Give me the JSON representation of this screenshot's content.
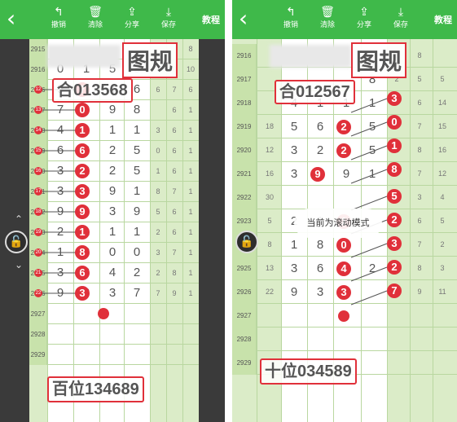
{
  "toolbar": {
    "undo": "撤销",
    "clear": "清除",
    "share": "分享",
    "save": "保存",
    "course": "教程"
  },
  "left": {
    "title": "图规",
    "sum_label": "合013568",
    "result_label": "百位134689",
    "rows": [
      {
        "no": "2915",
        "nums": [
          "",
          "",
          "",
          ""
        ],
        "side": [
          "",
          "",
          "8",
          "11"
        ]
      },
      {
        "no": "2916",
        "nums": [
          "0",
          "1",
          "5",
          "8"
        ],
        "side": [
          "7",
          "0",
          "10"
        ]
      },
      {
        "no": "2916",
        "nums": [
          "9",
          "7",
          "4",
          "6"
        ],
        "side": [
          "6",
          "7",
          "6"
        ]
      },
      {
        "no": "2917",
        "nums": [
          "7",
          "0",
          "9",
          "8"
        ],
        "side": [
          "",
          "6",
          "1"
        ]
      },
      {
        "no": "2918",
        "nums": [
          "4",
          "1",
          "1",
          "1"
        ],
        "side": [
          "3",
          "6",
          "1"
        ]
      },
      {
        "no": "2919",
        "nums": [
          "6",
          "6",
          "2",
          "5"
        ],
        "side": [
          "0",
          "6",
          "1"
        ]
      },
      {
        "no": "2920",
        "nums": [
          "3",
          "2",
          "2",
          "5"
        ],
        "side": [
          "1",
          "6",
          "1"
        ]
      },
      {
        "no": "2921",
        "nums": [
          "3",
          "3",
          "9",
          "1"
        ],
        "side": [
          "8",
          "7",
          "1"
        ]
      },
      {
        "no": "2922",
        "nums": [
          "9",
          "9",
          "3",
          "9"
        ],
        "side": [
          "5",
          "6",
          "1"
        ]
      },
      {
        "no": "2923",
        "nums": [
          "2",
          "1",
          "1",
          "1"
        ],
        "side": [
          "2",
          "6",
          "1"
        ]
      },
      {
        "no": "2924",
        "nums": [
          "1",
          "8",
          "0",
          "0"
        ],
        "side": [
          "3",
          "7",
          "1"
        ]
      },
      {
        "no": "2925",
        "nums": [
          "3",
          "6",
          "4",
          "2"
        ],
        "side": [
          "2",
          "8",
          "1"
        ]
      },
      {
        "no": "2926",
        "nums": [
          "9",
          "3",
          "3",
          "7"
        ],
        "side": [
          "7",
          "9",
          "1"
        ]
      },
      {
        "no": "2927",
        "nums": [
          "",
          "",
          "",
          ""
        ],
        "side": [
          "",
          "",
          ""
        ]
      },
      {
        "no": "2928",
        "nums": [
          "",
          "",
          "",
          ""
        ],
        "side": [
          "",
          "",
          ""
        ]
      },
      {
        "no": "2929",
        "nums": [
          "",
          "",
          "",
          ""
        ],
        "side": [
          "",
          "",
          ""
        ]
      }
    ],
    "circles": [
      "7",
      "0",
      "1",
      "6",
      "2",
      "3",
      "9",
      "1",
      "8",
      "6",
      "3"
    ]
  },
  "right": {
    "title": "图规",
    "sum_label": "合012567",
    "result_label": "十位034589",
    "toast": "当前为滚动模式",
    "rows": [
      {
        "no": "2916",
        "nums": [
          "",
          "",
          "",
          ""
        ],
        "side": [
          "3",
          "8"
        ]
      },
      {
        "no": "2917",
        "nums": [
          "",
          "",
          "",
          "8"
        ],
        "side": [
          "2",
          "5",
          "5"
        ]
      },
      {
        "no": "2918",
        "nums": [
          "4",
          "1",
          "1",
          "1"
        ],
        "side": [
          "3",
          "6",
          "14"
        ]
      },
      {
        "no": "2919",
        "nums": [
          "5",
          "6",
          "2",
          "5"
        ],
        "side": [
          "0",
          "7",
          "15"
        ],
        "left": "18"
      },
      {
        "no": "2920",
        "nums": [
          "3",
          "2",
          "2",
          "5"
        ],
        "side": [
          "1",
          "8",
          "16"
        ],
        "left": "12"
      },
      {
        "no": "2921",
        "nums": [
          "3",
          "3",
          "9",
          "1"
        ],
        "side": [
          "8",
          "7",
          "12"
        ],
        "left": "16"
      },
      {
        "no": "2922",
        "nums": [
          "",
          "",
          "",
          ""
        ],
        "side": [
          "5",
          "3",
          "4"
        ],
        "left": "30"
      },
      {
        "no": "2923",
        "nums": [
          "2",
          "1",
          "1",
          ""
        ],
        "side": [
          "2",
          "6",
          "5"
        ],
        "left": "5"
      },
      {
        "no": "2924",
        "nums": [
          "1",
          "8",
          "0",
          ""
        ],
        "side": [
          "3",
          "7",
          "2"
        ],
        "left": "8"
      },
      {
        "no": "2925",
        "nums": [
          "3",
          "6",
          "4",
          "2"
        ],
        "side": [
          "2",
          "8",
          "3"
        ],
        "left": "13"
      },
      {
        "no": "2926",
        "nums": [
          "9",
          "3",
          "3",
          ""
        ],
        "side": [
          "7",
          "9",
          "11"
        ],
        "left": "22"
      },
      {
        "no": "2927",
        "nums": [
          "",
          "",
          "",
          ""
        ],
        "side": [
          "",
          "",
          ""
        ]
      },
      {
        "no": "2928",
        "nums": [
          "",
          "",
          "",
          ""
        ],
        "side": [
          "",
          "",
          ""
        ]
      },
      {
        "no": "2929",
        "nums": [
          "",
          "",
          "",
          ""
        ],
        "side": [
          "",
          "",
          ""
        ]
      }
    ],
    "circles": [
      "2",
      "2",
      "9",
      "1",
      "0",
      "4",
      "3"
    ],
    "right_circles": [
      "3",
      "0",
      "1",
      "8",
      "5",
      "2",
      "3",
      "2",
      "7"
    ]
  }
}
